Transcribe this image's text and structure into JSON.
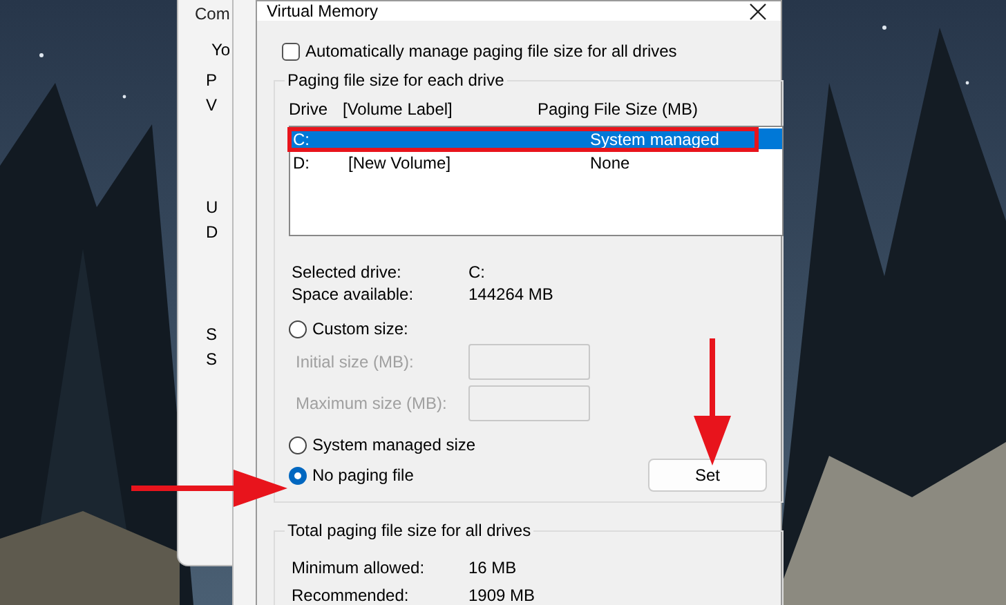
{
  "background_window": {
    "tab": "Com",
    "letters": [
      "Yo",
      "P",
      "V",
      "U",
      "D",
      "S",
      "S"
    ]
  },
  "dialog": {
    "title": "Virtual Memory",
    "auto_manage": {
      "label": "Automatically manage paging file size for all drives",
      "checked": false
    },
    "drives_group": {
      "title": "Paging file size for each drive",
      "columns": [
        "Drive",
        "[Volume Label]",
        "Paging File Size (MB)"
      ],
      "rows": [
        {
          "drive": "C:",
          "size": "System managed",
          "selected": true
        },
        {
          "drive": "D:",
          "volume": "[New Volume]",
          "size": "None",
          "selected": false
        }
      ],
      "info": [
        {
          "label": "Selected drive:",
          "value": "C:"
        },
        {
          "label": "Space available:",
          "value": "144264 MB"
        }
      ],
      "custom_size": {
        "label": "Custom size:",
        "selected": false
      },
      "size_fields": [
        {
          "label": "Initial size (MB):",
          "disabled": true
        },
        {
          "label": "Maximum size (MB):",
          "disabled": true
        }
      ],
      "other_options": [
        {
          "label": "System managed size",
          "selected": false
        },
        {
          "label": "No paging file",
          "selected": true
        }
      ],
      "set_button": "Set"
    },
    "totals_group": {
      "title": "Total paging file size for all drives",
      "rows": [
        {
          "label": "Minimum allowed:",
          "value": "16 MB"
        },
        {
          "label": "Recommended:",
          "value": "1909 MB"
        }
      ]
    }
  }
}
